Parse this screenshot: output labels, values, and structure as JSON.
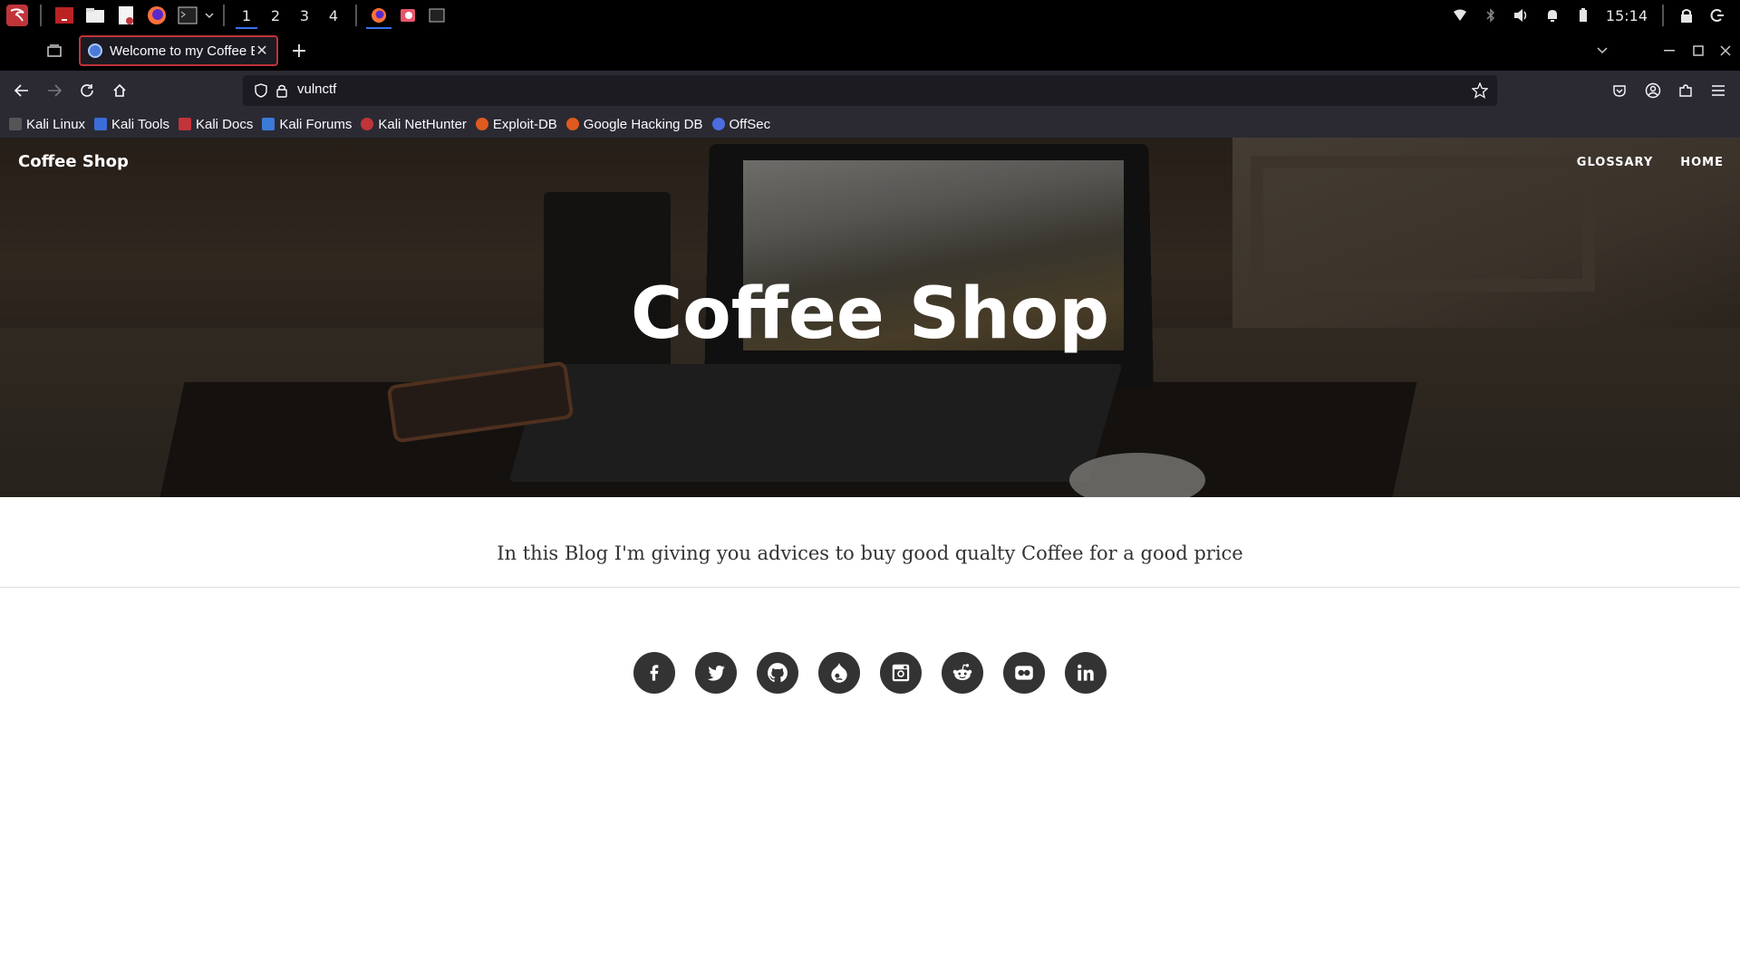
{
  "taskbar": {
    "workspaces": [
      "1",
      "2",
      "3",
      "4"
    ],
    "clock": "15:14"
  },
  "browser": {
    "tab_title": "Welcome to my Coffee Bl",
    "url": "vulnctf",
    "bookmarks": [
      "Kali Linux",
      "Kali Tools",
      "Kali Docs",
      "Kali Forums",
      "Kali NetHunter",
      "Exploit-DB",
      "Google Hacking DB",
      "OffSec"
    ]
  },
  "site": {
    "brand": "Coffee Shop",
    "nav": [
      "GLOSSARY",
      "HOME"
    ],
    "hero_title": "Coffee Shop",
    "intro": "In this Blog I'm giving you advices to buy good qualty Coffee for a good price",
    "socials": [
      "facebook-icon",
      "twitter-icon",
      "github-icon",
      "drupal-icon",
      "instagram-icon",
      "reddit-icon",
      "flickr-icon",
      "linkedin-icon"
    ]
  },
  "colors": {
    "taskbar_bg": "#000000",
    "toolbar_bg": "#2b2a33",
    "tab_border": "#c0343a",
    "accent": "#3a6ff2",
    "social_bg": "#333333"
  }
}
